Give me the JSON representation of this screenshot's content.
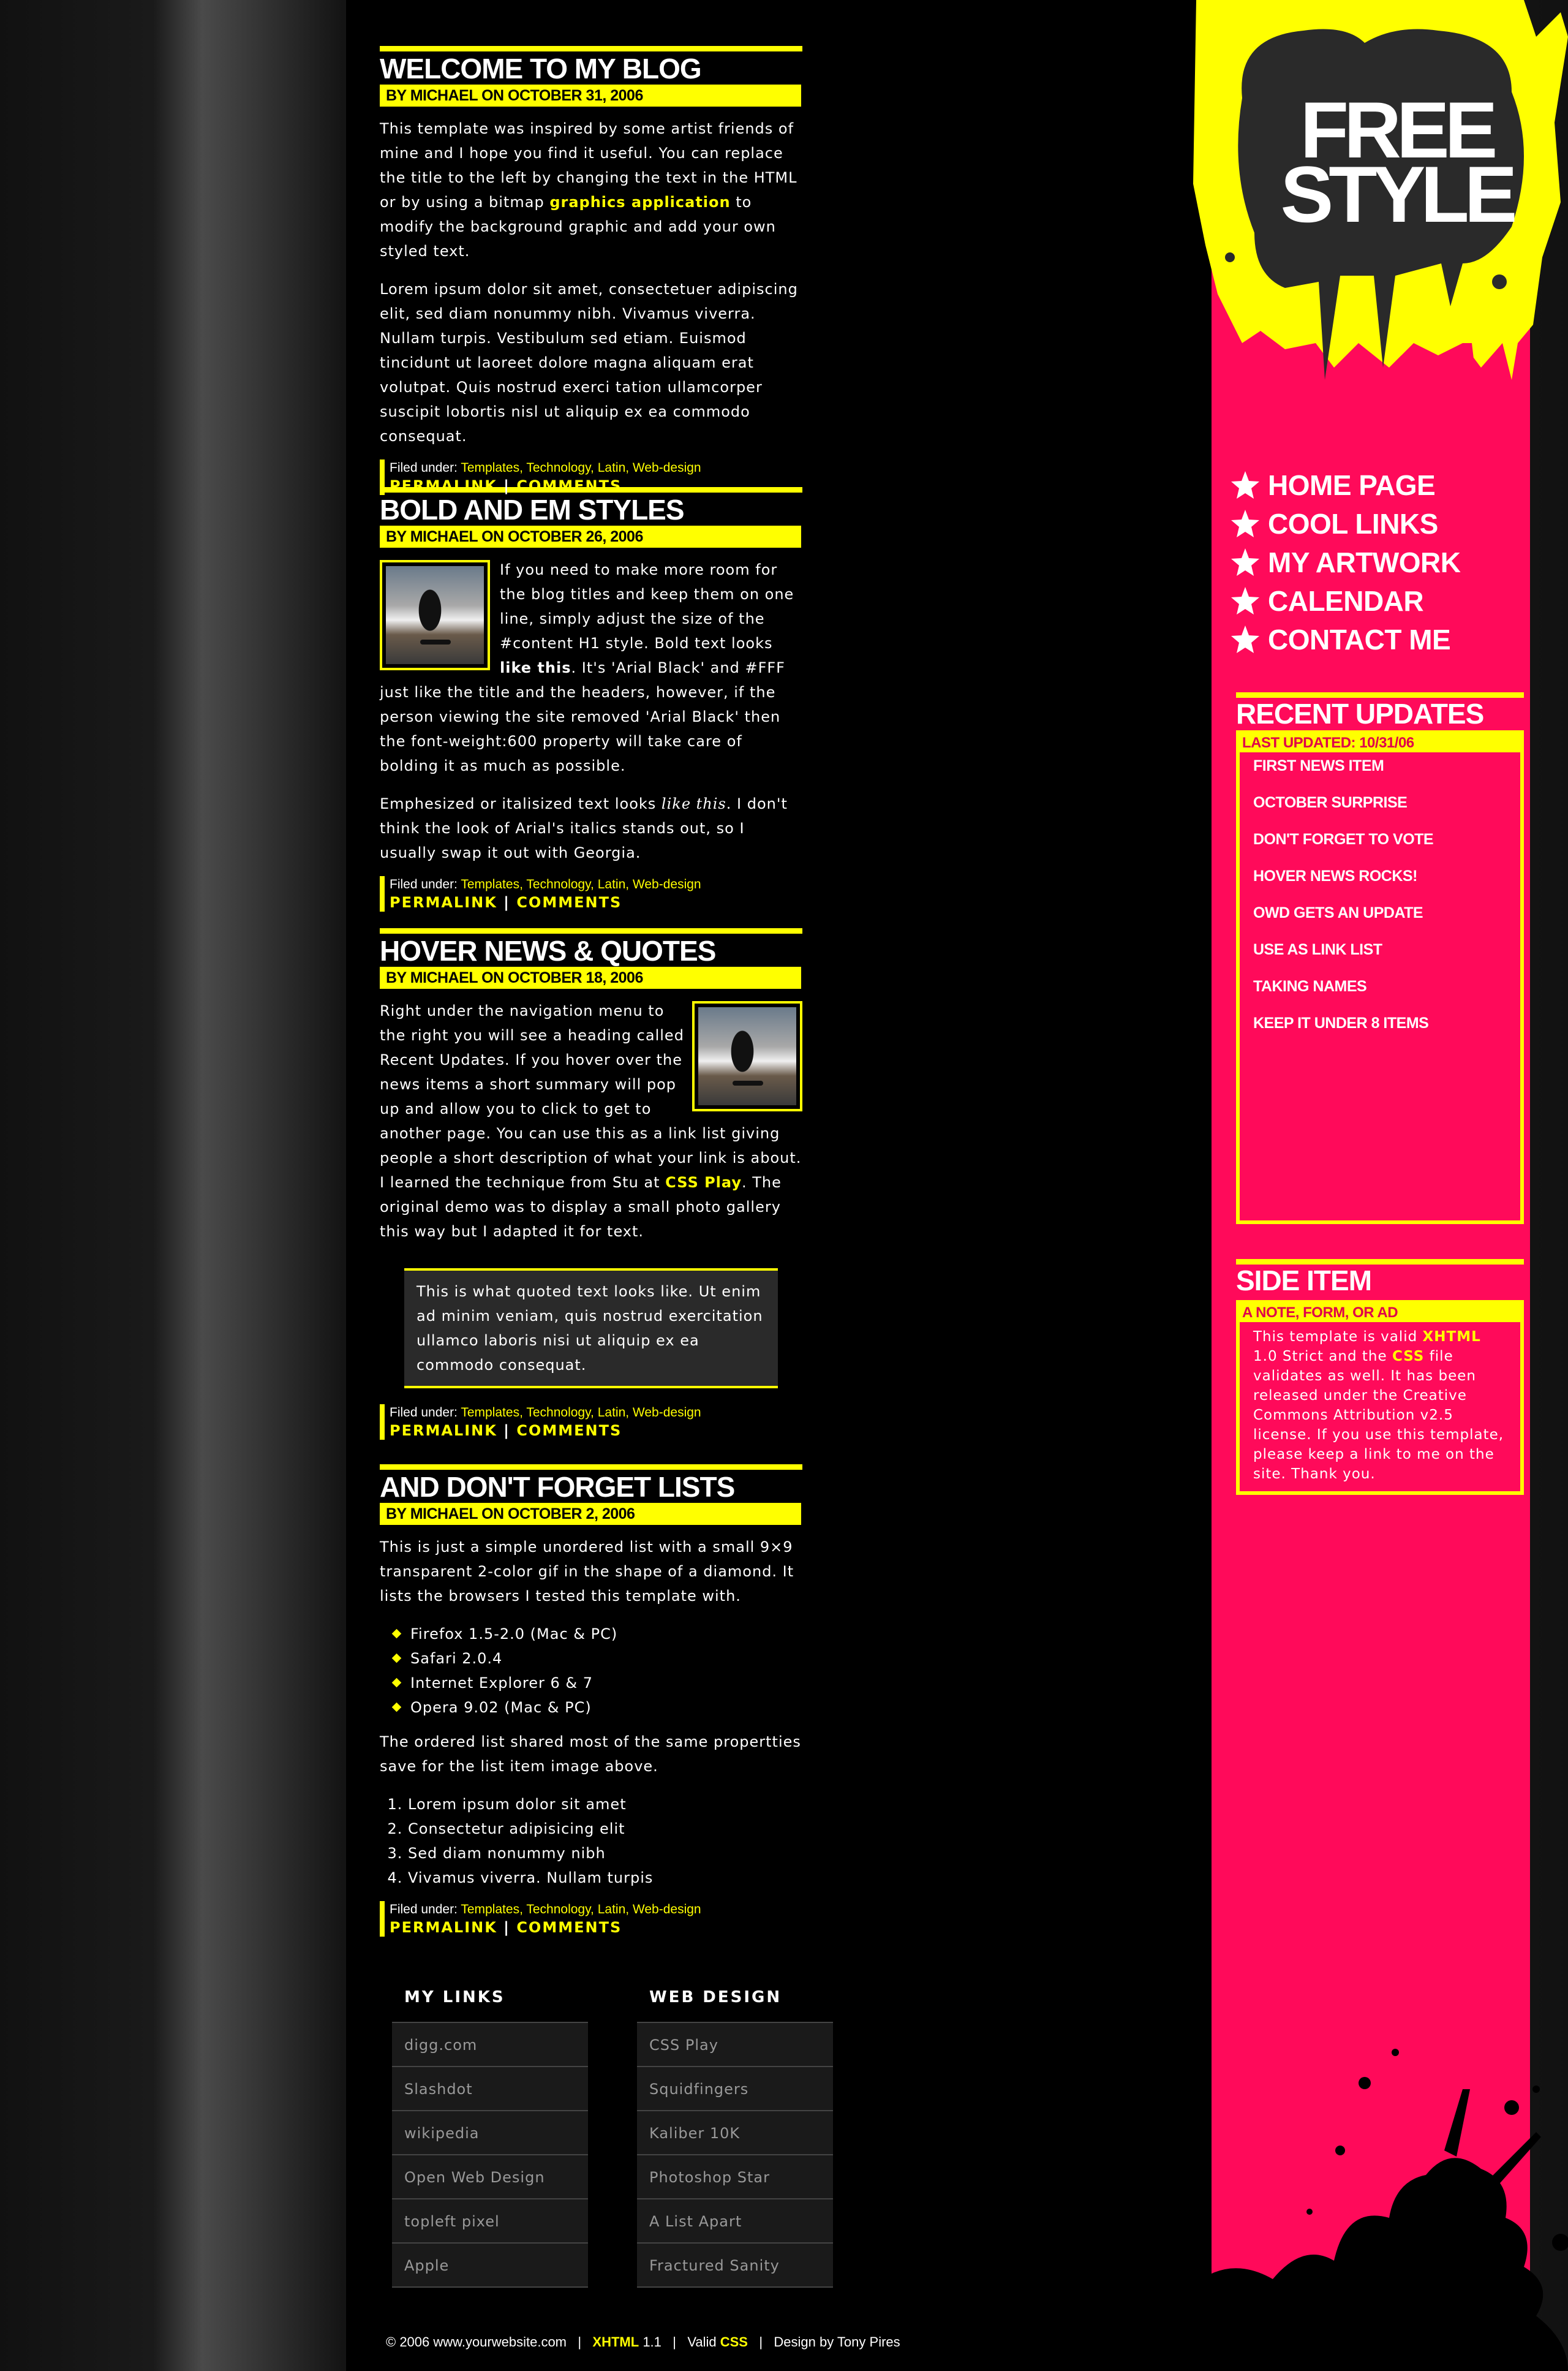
{
  "posts": [
    {
      "title": "WELCOME TO MY BLOG",
      "meta": "BY MICHAEL ON OCTOBER 31, 2006",
      "p1_a": "This template was inspired by some artist friends of mine and I hope you find it useful. You can replace the title to the left by changing the text in the HTML or by using a bitmap ",
      "p1_link": "graphics application",
      "p1_b": " to modify the background graphic and add your own styled text.",
      "p2": "Lorem ipsum dolor sit amet, consectetuer adipiscing elit, sed diam nonummy nibh. Vivamus viverra. Nullam turpis. Vestibulum sed etiam. Euismod tincidunt ut laoreet dolore magna aliquam erat volutpat. Quis nostrud exerci tation ullamcorper suscipit lobortis nisl ut aliquip ex ea commodo consequat."
    },
    {
      "title": "BOLD AND EM STYLES",
      "meta": "BY MICHAEL ON OCTOBER 26, 2006",
      "p1_a": "If you need to make more room for the blog titles and keep them on one line, simply adjust the size of the #content H1 style. Bold text looks ",
      "p1_bold": "like this",
      "p1_b": ". It's 'Arial Black' and #FFF just like the title and the headers, however, if the person viewing the site removed 'Arial Black' then the font-weight:600 property will take care of bolding it as much as possible.",
      "p2_a": "Emphesized or italisized text looks ",
      "p2_em": "like this",
      "p2_b": ". I don't think the look of Arial's italics stands out, so I usually swap it out with Georgia."
    },
    {
      "title": "HOVER NEWS & QUOTES",
      "meta": "BY MICHAEL ON OCTOBER 18, 2006",
      "p1_a": "Right under the navigation menu to the right you will see a heading called Recent Updates. If you hover over the news items a short summary will pop up and allow you to click to get to another page. You can use this as a link list giving people a short description of what your link is about. I learned the technique from Stu at ",
      "p1_link": "CSS Play",
      "p1_b": ". The original demo was to display a small photo gallery this way but I adapted it for text.",
      "quote": "This is what quoted text looks like. Ut enim ad minim veniam, quis nostrud exercitation ullamco laboris nisi ut aliquip ex ea commodo consequat."
    },
    {
      "title": "AND DON'T FORGET LISTS",
      "meta": "BY MICHAEL ON OCTOBER 2, 2006",
      "p1": "This is just a simple unordered list with a small 9×9 transparent 2-color gif in the shape of a diamond. It lists the browsers I tested this template with.",
      "ul": [
        "Firefox 1.5-2.0 (Mac & PC)",
        "Safari 2.0.4",
        "Internet Explorer 6 & 7",
        "Opera 9.02 (Mac & PC)"
      ],
      "p2": "The ordered list shared most of the same propertties save for the list item image above.",
      "ol": [
        "Lorem ipsum dolor sit amet",
        "Consectetur adipisicing elit",
        "Sed diam nonummy nibh",
        "Vivamus viverra. Nullam turpis"
      ]
    }
  ],
  "filed": {
    "label": "Filed under: ",
    "cats": "Templates, Technology, Latin, Web-design",
    "permalink": "PERMALINK",
    "sep": " | ",
    "comments": "COMMENTS"
  },
  "footer_links": {
    "my_links": {
      "title": "MY LINKS",
      "items": [
        "digg.com",
        "Slashdot",
        "wikipedia",
        "Open Web Design",
        "topleft pixel",
        "Apple"
      ]
    },
    "web_design": {
      "title": "WEB DESIGN",
      "items": [
        "CSS Play",
        "Squidfingers",
        "Kaliber 10K",
        "Photoshop Star",
        "A List Apart",
        "Fractured Sanity"
      ]
    }
  },
  "footer": {
    "copy": "© 2006 www.yourwebsite.com",
    "sep": "|",
    "xhtml": "XHTML",
    "xhtml_ver": "1.1",
    "valid": "Valid",
    "css": "CSS",
    "design": "Design by Tony Pires"
  },
  "logo": {
    "line1": "FREE",
    "line2": "STYLE"
  },
  "nav": [
    "HOME PAGE",
    "COOL LINKS",
    "MY ARTWORK",
    "CALENDAR",
    "CONTACT ME"
  ],
  "recent": {
    "title": "RECENT UPDATES",
    "sub": "LAST UPDATED: 10/31/06",
    "items": [
      "FIRST NEWS ITEM",
      "OCTOBER SURPRISE",
      "DON'T FORGET TO VOTE",
      "HOVER NEWS ROCKS!",
      "OWD GETS AN UPDATE",
      "USE AS LINK LIST",
      "TAKING NAMES",
      "KEEP IT UNDER 8 ITEMS"
    ]
  },
  "side_item": {
    "title": "SIDE ITEM",
    "sub": "A NOTE, FORM, OR AD",
    "t1": "This template is valid ",
    "xhtml": "XHTML",
    "t2": " 1.0 Strict and the ",
    "css": "CSS",
    "t3": " file validates as well. It has been released under the Creative Commons Attribution v2.5 license. If you use this template, please keep a link to me on the site. Thank you."
  },
  "colors": {
    "accent": "#ffff00",
    "pink": "#ff0a5a",
    "bg": "#000000"
  }
}
